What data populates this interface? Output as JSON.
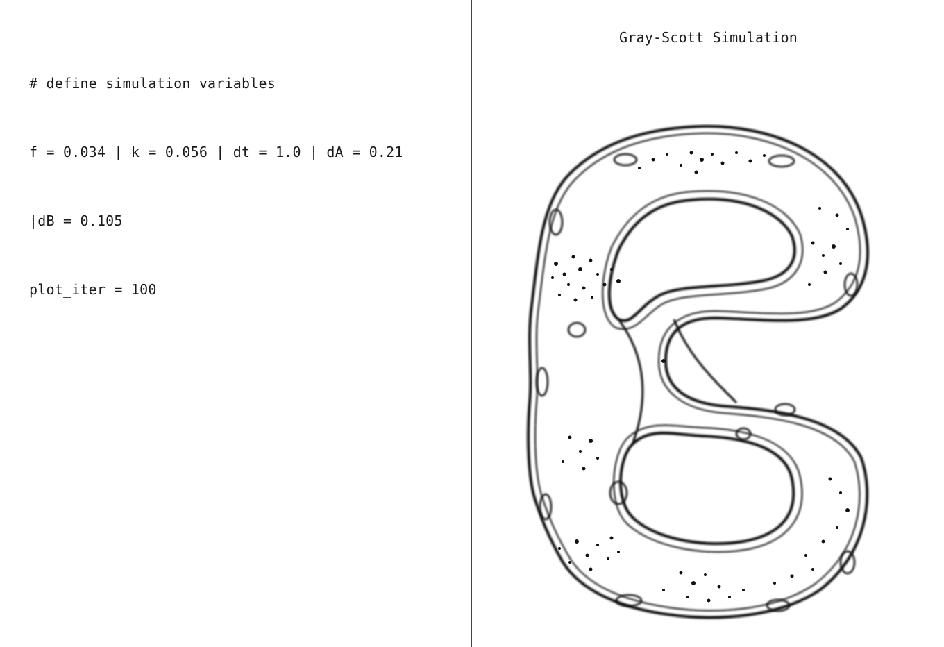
{
  "code": {
    "lines": [
      "# define simulation variables",
      "f = 0.034 | k = 0.056 | dt = 1.0 | dA = 0.21",
      "|dB = 0.105",
      "plot_iter = 100"
    ]
  },
  "simulation": {
    "title": "Gray-Scott Simulation",
    "pattern_shape": "letter-B",
    "colors": {
      "background": "#ffffff",
      "ink": "#111111"
    }
  }
}
